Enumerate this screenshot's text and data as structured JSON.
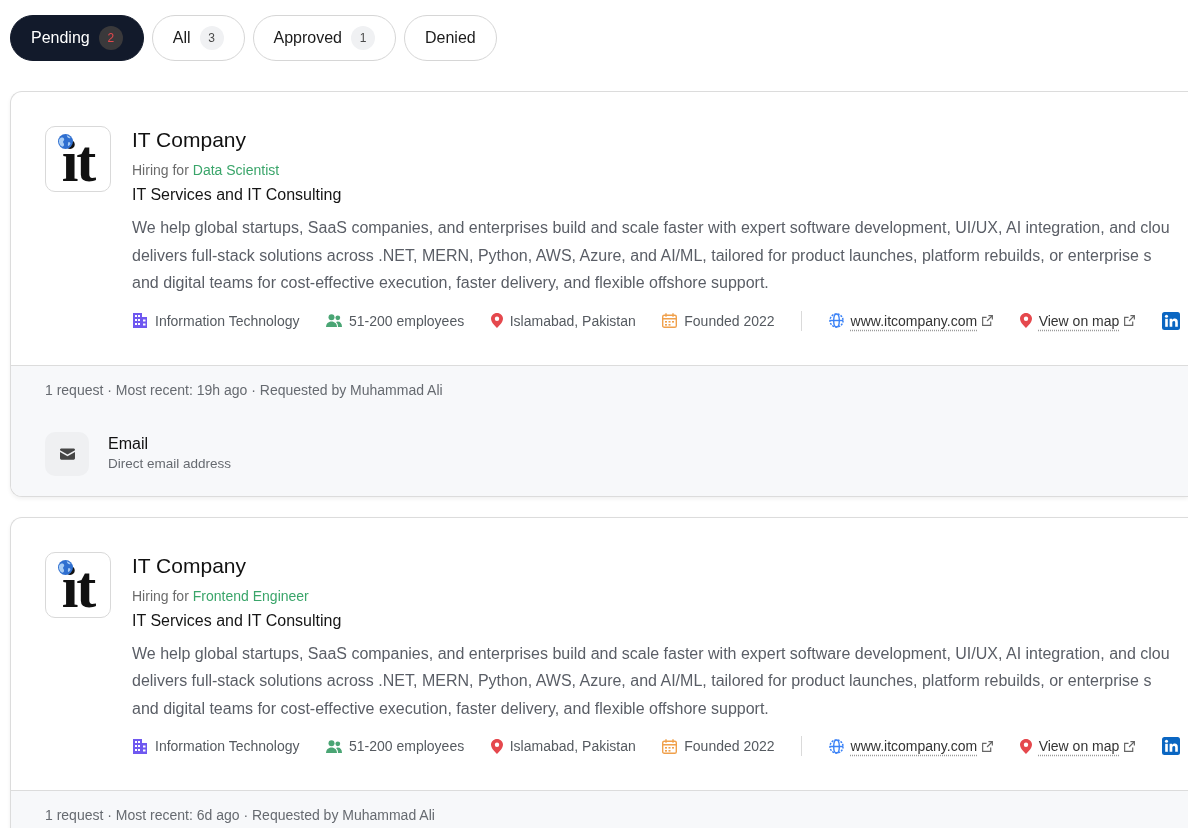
{
  "tabs": [
    {
      "label": "Pending",
      "count": "2",
      "selected": true
    },
    {
      "label": "All",
      "count": "3",
      "selected": false
    },
    {
      "label": "Approved",
      "count": "1",
      "selected": false
    },
    {
      "label": "Denied",
      "selected": false
    }
  ],
  "cards": [
    {
      "logo": {
        "text": "it"
      },
      "company": "IT Company",
      "hiring_label": "Hiring for",
      "role": "Data Scientist",
      "industry": "IT Services and IT Consulting",
      "description": "We help global startups, SaaS companies, and enterprises build and scale faster with expert software development, UI/UX, AI integration, and clou\ndelivers full-stack solutions across .NET, MERN, Python, AWS, Azure, and AI/ML, tailored for product launches, platform rebuilds, or enterprise s\nand digital teams for cost-effective execution, faster delivery, and flexible offshore support.",
      "facts": [
        {
          "kind": "industry",
          "text": "Information Technology"
        },
        {
          "kind": "size",
          "text": "51-200 employees"
        },
        {
          "kind": "location",
          "text": "Islamabad, Pakistan"
        },
        {
          "kind": "founded",
          "text": "Founded 2022"
        }
      ],
      "links": [
        {
          "kind": "website",
          "text": "www.itcompany.com"
        },
        {
          "kind": "map",
          "text": "View on map"
        },
        {
          "kind": "linkedin"
        }
      ],
      "request_summary": "1 request · Most recent: 19h ago · Requested by Muhammad Ali",
      "contacts": [
        {
          "kind": "email",
          "label": "Email",
          "detail": "Direct email address"
        }
      ]
    },
    {
      "logo": {
        "text": "it"
      },
      "company": "IT Company",
      "hiring_label": "Hiring for",
      "role": "Frontend Engineer",
      "industry": "IT Services and IT Consulting",
      "description": "We help global startups, SaaS companies, and enterprises build and scale faster with expert software development, UI/UX, AI integration, and clou\ndelivers full-stack solutions across .NET, MERN, Python, AWS, Azure, and AI/ML, tailored for product launches, platform rebuilds, or enterprise s\nand digital teams for cost-effective execution, faster delivery, and flexible offshore support.",
      "facts": [
        {
          "kind": "industry",
          "text": "Information Technology"
        },
        {
          "kind": "size",
          "text": "51-200 employees"
        },
        {
          "kind": "location",
          "text": "Islamabad, Pakistan"
        },
        {
          "kind": "founded",
          "text": "Founded 2022"
        }
      ],
      "links": [
        {
          "kind": "website",
          "text": "www.itcompany.com"
        },
        {
          "kind": "map",
          "text": "View on map"
        },
        {
          "kind": "linkedin"
        }
      ],
      "request_summary": "1 request · Most recent: 6d ago · Requested by Muhammad Ali"
    }
  ]
}
